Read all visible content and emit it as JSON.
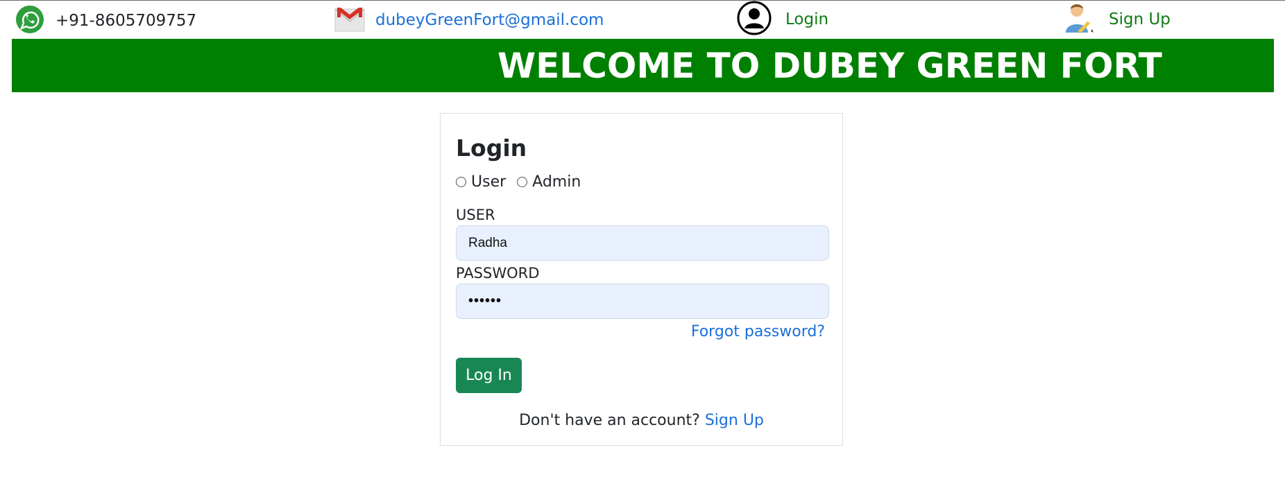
{
  "topbar": {
    "phone": "+91-8605709757",
    "email": "dubeyGreenFort@gmail.com",
    "login_label": "Login",
    "signup_label": "Sign Up"
  },
  "banner": {
    "title": "WELCOME TO DUBEY GREEN FORT"
  },
  "login_form": {
    "title": "Login",
    "role_options": [
      "User",
      "Admin"
    ],
    "selected_role": null,
    "user_label": "USER",
    "user_value": "Radha",
    "password_label": "PASSWORD",
    "password_value": "••••••",
    "forgot_label": "Forgot password?",
    "submit_label": "Log In",
    "no_account_text": "Don't have an account?",
    "signup_link": "Sign Up"
  },
  "colors": {
    "banner_green": "#008000",
    "link_green": "#0f7b14",
    "link_blue": "#1a6fd8",
    "button_green": "#198754",
    "input_bg": "#e8f0fe"
  },
  "icons": [
    "whatsapp-icon",
    "gmail-icon",
    "user-account-icon",
    "signup-person-icon"
  ]
}
